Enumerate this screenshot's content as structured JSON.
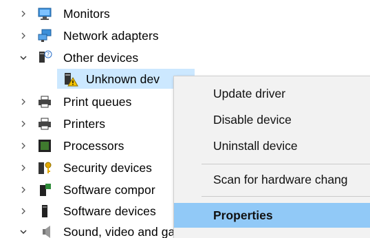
{
  "tree": {
    "items": [
      {
        "label": "Monitors",
        "expanded": false,
        "icon": "monitor-icon"
      },
      {
        "label": "Network adapters",
        "expanded": false,
        "icon": "network-adapter-icon"
      },
      {
        "label": "Other devices",
        "expanded": true,
        "icon": "other-devices-icon"
      },
      {
        "label": "Unknown dev",
        "selected": true,
        "icon": "unknown-device-warning-icon"
      },
      {
        "label": "Print queues",
        "expanded": false,
        "icon": "printer-icon"
      },
      {
        "label": "Printers",
        "expanded": false,
        "icon": "printer-icon"
      },
      {
        "label": "Processors",
        "expanded": false,
        "icon": "processor-icon"
      },
      {
        "label": "Security devices",
        "expanded": false,
        "icon": "security-device-icon"
      },
      {
        "label": "Software compor",
        "expanded": false,
        "icon": "software-component-icon"
      },
      {
        "label": "Software devices",
        "expanded": false,
        "icon": "software-device-icon"
      },
      {
        "label": "Sound, video and game controllers",
        "expanded": true,
        "icon": "speaker-icon"
      }
    ]
  },
  "context_menu": {
    "items": [
      {
        "label": "Update driver"
      },
      {
        "label": "Disable device"
      },
      {
        "label": "Uninstall device"
      },
      {
        "label": "Scan for hardware chang"
      },
      {
        "label": "Properties",
        "highlighted": true
      }
    ]
  },
  "colors": {
    "selection": "#cce8ff",
    "menu_highlight": "#91c9f7",
    "menu_background": "#f2f2f2"
  }
}
